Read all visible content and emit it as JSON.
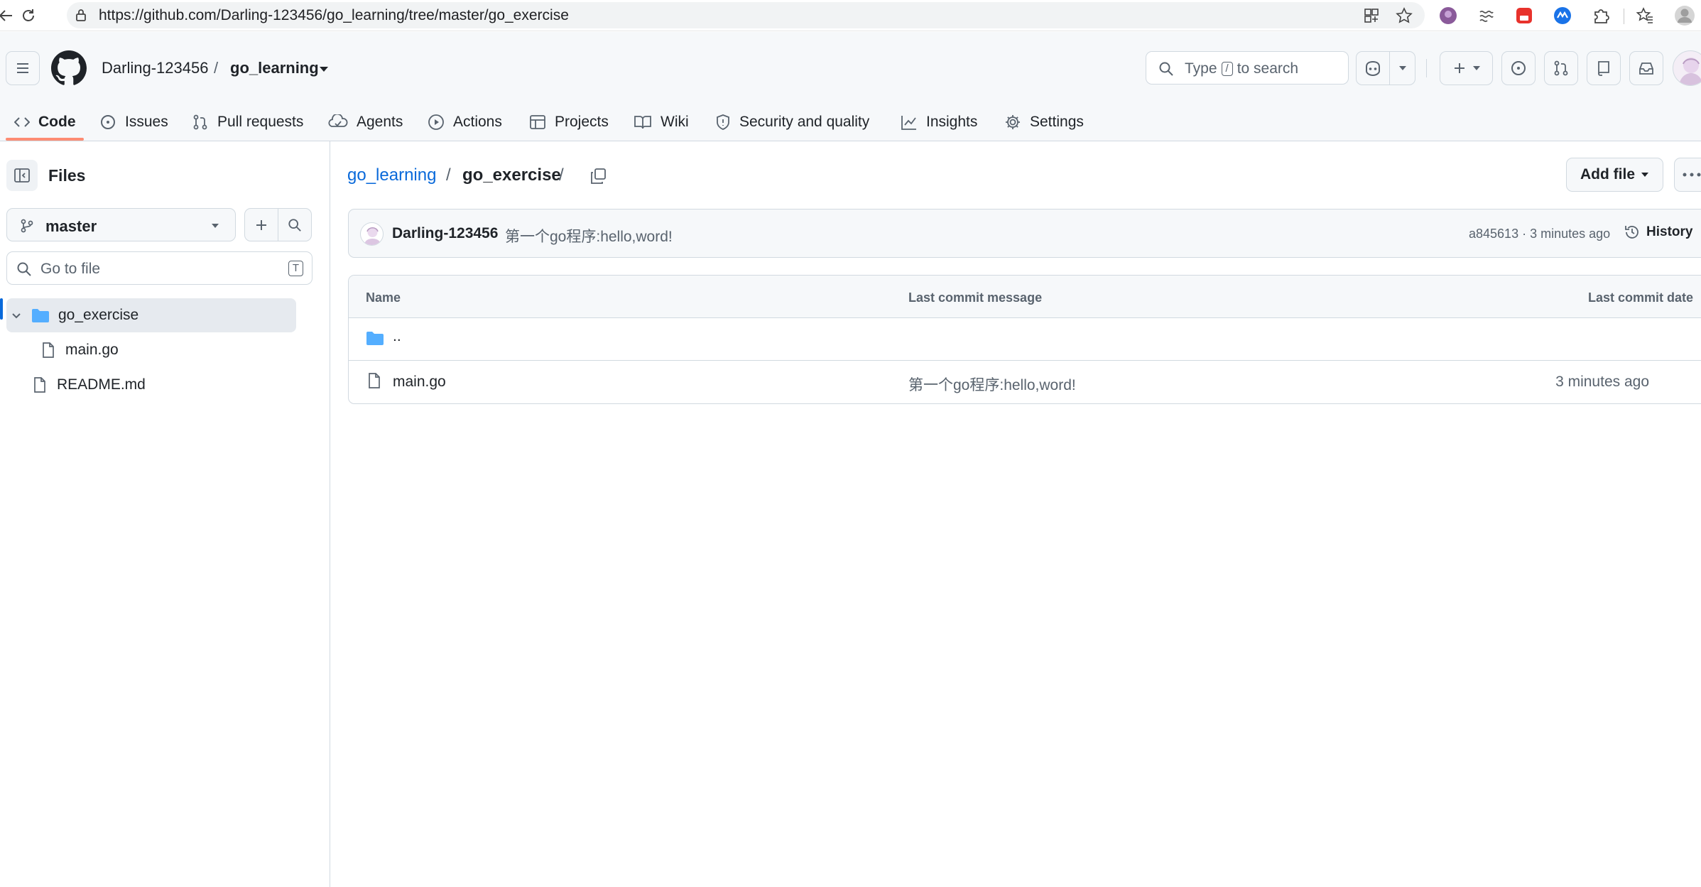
{
  "browser": {
    "url": "https://github.com/Darling-123456/go_learning/tree/master/go_exercise"
  },
  "header": {
    "owner": "Darling-123456",
    "separator": "/",
    "repo": "go_learning",
    "search": {
      "prefix": "Type",
      "key": "/",
      "suffix": "to search"
    }
  },
  "tabs": [
    {
      "label": "Code",
      "icon": "code-icon",
      "active": true
    },
    {
      "label": "Issues",
      "icon": "issue-icon"
    },
    {
      "label": "Pull requests",
      "icon": "pull-request-icon"
    },
    {
      "label": "Agents",
      "icon": "agents-icon"
    },
    {
      "label": "Actions",
      "icon": "play-icon"
    },
    {
      "label": "Projects",
      "icon": "table-icon"
    },
    {
      "label": "Wiki",
      "icon": "book-icon"
    },
    {
      "label": "Security and quality",
      "icon": "shield-icon"
    },
    {
      "label": "Insights",
      "icon": "graph-icon"
    },
    {
      "label": "Settings",
      "icon": "gear-icon"
    }
  ],
  "tree": {
    "title": "Files",
    "branch": "master",
    "goto_placeholder": "Go to file",
    "goto_key": "T",
    "items": [
      {
        "name": "go_exercise",
        "type": "folder",
        "expanded": true
      },
      {
        "name": "main.go",
        "type": "file"
      },
      {
        "name": "README.md",
        "type": "file"
      }
    ]
  },
  "breadcrumb": {
    "repo_link": "go_learning",
    "sep": "/",
    "current": "go_exercise",
    "trailing": "/"
  },
  "actions": {
    "add_file": "Add file"
  },
  "commit": {
    "author": "Darling-123456",
    "message": "第一个go程序:hello,word!",
    "meta": "a845613 · 3 minutes ago",
    "history": "History"
  },
  "files_table": {
    "headers": {
      "name": "Name",
      "message": "Last commit message",
      "date": "Last commit date"
    },
    "rows": [
      {
        "name": "..",
        "type": "folder",
        "message": "",
        "date": ""
      },
      {
        "name": "main.go",
        "type": "file",
        "message": "第一个go程序:hello,word!",
        "date": "3 minutes ago"
      }
    ]
  },
  "colors": {
    "link": "#0969da",
    "tab_underline": "#fd8c73",
    "folder": "#54aeff",
    "border": "#d1d9e0"
  }
}
